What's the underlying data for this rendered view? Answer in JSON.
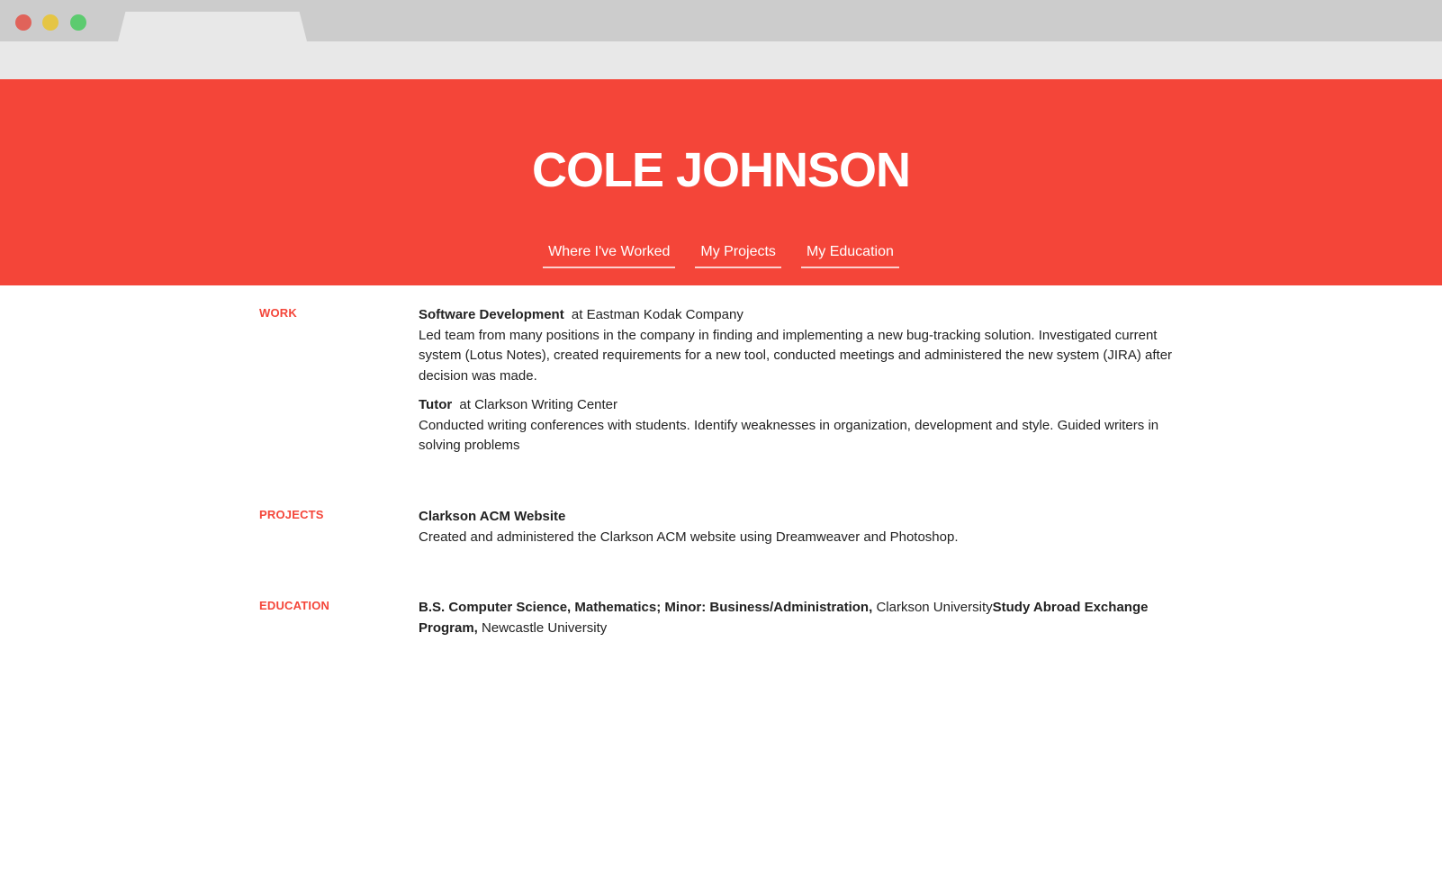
{
  "window": {
    "controls": [
      "close",
      "minimize",
      "maximize"
    ]
  },
  "header": {
    "name": "COLE JOHNSON",
    "nav": [
      {
        "label": "Where I've Worked"
      },
      {
        "label": "My Projects"
      },
      {
        "label": "My Education"
      }
    ],
    "accent_color": "#f44539"
  },
  "work": {
    "label": "WORK",
    "entries": [
      {
        "title": "Software Development",
        "org": "at Eastman Kodak Company",
        "description": "Led team from many positions in the company in finding and implementing a new bug-tracking solution. Investigated current system (Lotus Notes), created requirements for a new tool, conducted meetings and administered the new system (JIRA) after decision was made."
      },
      {
        "title": "Tutor",
        "org": "at Clarkson Writing Center",
        "description": "Conducted writing conferences with students. Identify weaknesses in organization, development and style. Guided writers in solving problems"
      }
    ]
  },
  "projects": {
    "label": "PROJECTS",
    "entries": [
      {
        "title": "Clarkson ACM Website",
        "description": "Created and administered the Clarkson ACM website using Dreamweaver and Photoshop."
      }
    ]
  },
  "education": {
    "label": "EDUCATION",
    "entries": [
      {
        "degree": "B.S. Computer Science, Mathematics; Minor: Business/Administration,",
        "school": "Clarkson University"
      },
      {
        "degree": "Study Abroad Exchange Program,",
        "school": "Newcastle University"
      }
    ]
  }
}
